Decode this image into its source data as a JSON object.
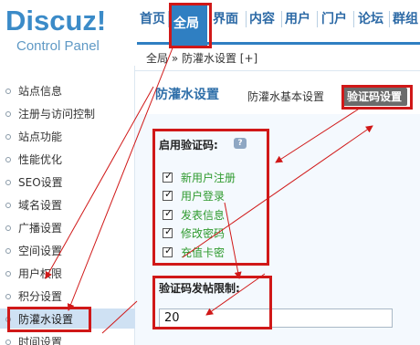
{
  "logo": {
    "main": "Discuz!",
    "sub": "Control Panel"
  },
  "topnav": {
    "items": [
      "首页",
      "全局",
      "界面",
      "内容",
      "用户",
      "门户",
      "论坛",
      "群组"
    ],
    "active": "全局"
  },
  "breadcrumb": {
    "text": "全局 » 防灌水设置 [+]"
  },
  "sidebar": {
    "items": [
      "站点信息",
      "注册与访问控制",
      "站点功能",
      "性能优化",
      "SEO设置",
      "域名设置",
      "广播设置",
      "空间设置",
      "用户权限",
      "积分设置",
      "防灌水设置",
      "时间设置"
    ],
    "active": "防灌水设置"
  },
  "main": {
    "title": "防灌水设置",
    "tabs": [
      "防灌水基本设置",
      "验证码设置"
    ],
    "active_tab": "验证码设置",
    "captcha_section": {
      "label": "启用验证码:",
      "options": [
        {
          "label": "新用户注册",
          "checked": true
        },
        {
          "label": "用户登录",
          "checked": true
        },
        {
          "label": "发表信息",
          "checked": true
        },
        {
          "label": "修改密码",
          "checked": true
        },
        {
          "label": "充值卡密",
          "checked": true
        }
      ]
    },
    "limit": {
      "label": "验证码发帖限制:",
      "value": "20"
    }
  },
  "icons": {
    "help": "help-icon",
    "checkbox_mark": "check-icon"
  },
  "colors": {
    "accent": "#2f7fc2",
    "annotation": "#d01818",
    "option_text": "#2e9a2e"
  }
}
